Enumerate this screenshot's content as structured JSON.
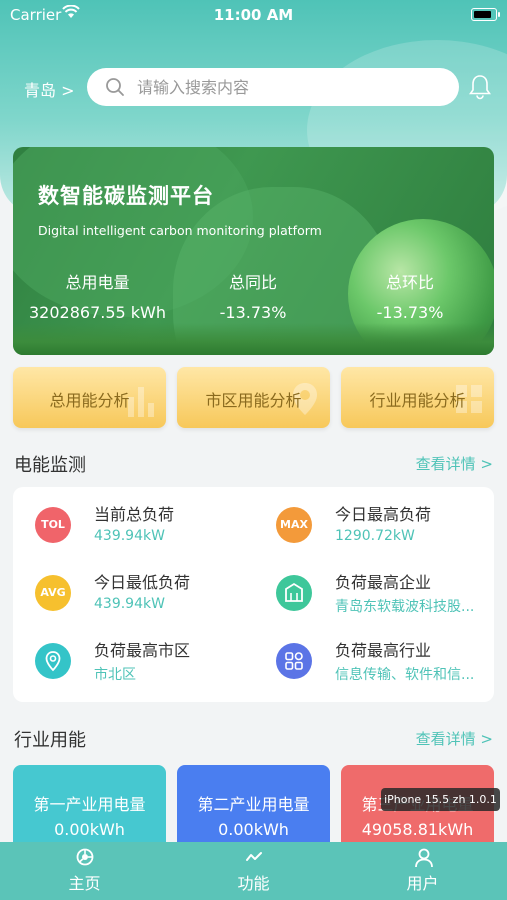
{
  "status_bar": {
    "carrier": "Carrier",
    "time": "11:00 AM"
  },
  "header": {
    "city": "青岛 >",
    "search_placeholder": "请输入搜索内容"
  },
  "banner": {
    "title": "数智能碳监测平台",
    "subtitle": "Digital intelligent carbon monitoring platform",
    "stats": [
      {
        "label": "总用电量",
        "value": "3202867.55 kWh"
      },
      {
        "label": "总同比",
        "value": "-13.73%"
      },
      {
        "label": "总环比",
        "value": "-13.73%"
      }
    ]
  },
  "quick_actions": [
    {
      "label": "总用能分析"
    },
    {
      "label": "市区用能分析"
    },
    {
      "label": "行业用能分析"
    }
  ],
  "monitoring": {
    "title": "电能监测",
    "more": "查看详情 >",
    "items": [
      {
        "icon_text": "TOL",
        "icon": "tol-icon",
        "color": "#f0646a",
        "title": "当前总负荷",
        "value": "439.94kW"
      },
      {
        "icon_text": "MAX",
        "icon": "max-icon",
        "color": "#f39a3a",
        "title": "今日最高负荷",
        "value": "1290.72kW"
      },
      {
        "icon_text": "AVG",
        "icon": "avg-icon",
        "color": "#f6c02e",
        "title": "今日最低负荷",
        "value": "439.94kW"
      },
      {
        "icon_text": "",
        "icon": "building-icon",
        "color": "#3ec79a",
        "title": "负荷最高企业",
        "value": "青岛东软载波科技股..."
      },
      {
        "icon_text": "",
        "icon": "location-icon",
        "color": "#34c4c8",
        "title": "负荷最高市区",
        "value": "市北区"
      },
      {
        "icon_text": "",
        "icon": "grid-icon",
        "color": "#5b74e6",
        "title": "负荷最高行业",
        "value": "信息传输、软件和信..."
      }
    ]
  },
  "industry": {
    "title": "行业用能",
    "more": "查看详情 >",
    "cards": [
      {
        "label": "第一产业用电量",
        "value": "0.00kWh",
        "color": "#46c8d0"
      },
      {
        "label": "第二产业用电量",
        "value": "0.00kWh",
        "color": "#4a7ef0"
      },
      {
        "label": "第三产业用电量",
        "value": "49058.81kWh",
        "color": "#ef6b6b"
      }
    ]
  },
  "debug_tooltip": "iPhone 15.5 zh 1.0.1",
  "tabs": [
    {
      "label": "主页",
      "icon": "home-icon"
    },
    {
      "label": "功能",
      "icon": "function-icon"
    },
    {
      "label": "用户",
      "icon": "user-icon"
    }
  ],
  "colors": {
    "accent": "#4fc3b7",
    "tabbar": "#5bc4b8"
  }
}
